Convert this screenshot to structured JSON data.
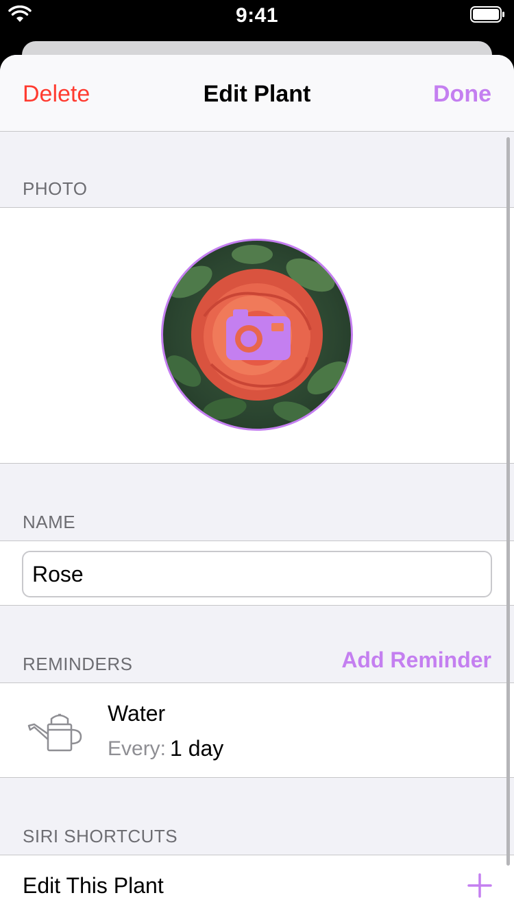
{
  "status_bar": {
    "time": "9:41"
  },
  "nav": {
    "delete_label": "Delete",
    "title": "Edit Plant",
    "done_label": "Done"
  },
  "sections": {
    "photo": "PHOTO",
    "name": "NAME",
    "reminders": "REMINDERS",
    "siri": "SIRI SHORTCUTS"
  },
  "name_field": {
    "value": "Rose"
  },
  "reminders": {
    "add_label": "Add Reminder",
    "items": [
      {
        "title": "Water",
        "freq_label": "Every:",
        "freq_value": "1 day",
        "icon": "watering-can-icon"
      }
    ]
  },
  "siri": {
    "items": [
      {
        "label": "Edit This Plant",
        "icon": "plus-icon"
      }
    ]
  },
  "colors": {
    "accent": "#c47ff0",
    "destructive": "#ff3b30"
  }
}
